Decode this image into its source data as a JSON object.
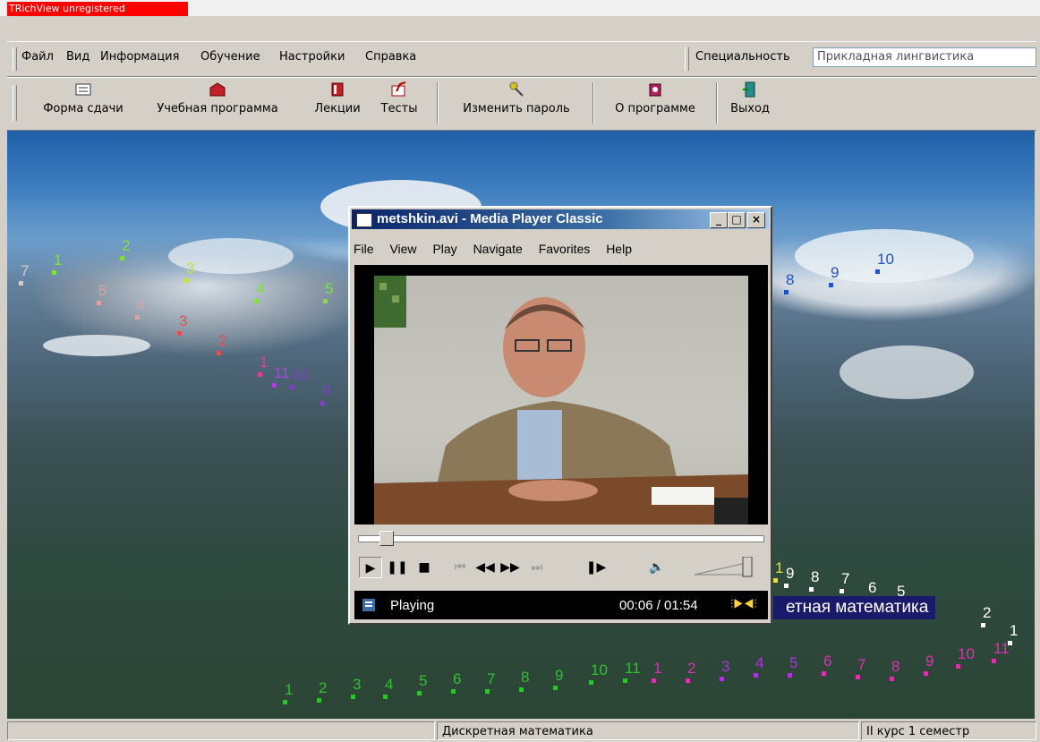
{
  "window": {
    "title": "TRichView unregistered"
  },
  "menu": {
    "items": [
      "Файл",
      "Вид",
      "Информация",
      "Обучение",
      "Настройки",
      "Справка"
    ],
    "specialty_label": "Специальность",
    "specialty_value": "Прикладная лингвистика"
  },
  "toolbar": {
    "form": "Форма сдачи",
    "program": "Учебная программа",
    "lectures": "Лекции",
    "tests": "Тесты",
    "change_password": "Изменить пароль",
    "about": "О программе",
    "exit": "Выход"
  },
  "scene": {
    "banner": "етная математика",
    "path_labels": [
      "7",
      "1",
      "2",
      "3",
      "5",
      "4",
      "5",
      "4",
      "3",
      "2",
      "1",
      "11",
      "10",
      "9",
      "8",
      "9",
      "10",
      "1",
      "9",
      "8",
      "7",
      "6",
      "5",
      "2",
      "1",
      "1",
      "2",
      "3",
      "4",
      "5",
      "6",
      "7",
      "8",
      "9",
      "10",
      "11",
      "1",
      "2",
      "3",
      "4",
      "5",
      "6",
      "7",
      "8",
      "9",
      "10",
      "11"
    ]
  },
  "player": {
    "title": "metshkin.avi - Media Player Classic",
    "menu": [
      "File",
      "View",
      "Play",
      "Navigate",
      "Favorites",
      "Help"
    ],
    "status": "Playing",
    "time": "00:06 / 01:54",
    "seek_fraction": 0.05,
    "volume_fraction": 1.0
  },
  "statusbar": {
    "subject": "Дискретная математика",
    "course": "II курс 1 семестр"
  },
  "colors": {
    "registration_red": "#ff0000",
    "title_blue": "#0a246a",
    "banner": "#1a1a6a"
  }
}
